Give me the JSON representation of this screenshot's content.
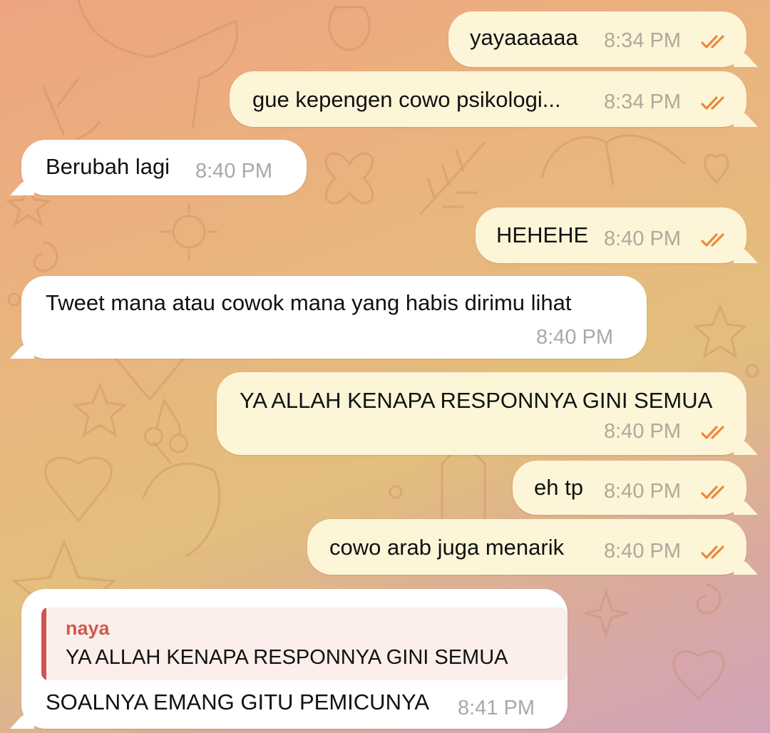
{
  "colors": {
    "outgoing_bubble": "#fdf5d8",
    "incoming_bubble": "#ffffff",
    "read_ticks": "#e8893b",
    "reply_accent": "#cf534f"
  },
  "messages": [
    {
      "direction": "out",
      "text": "yayaaaaaa",
      "time": "8:34 PM",
      "status": "read"
    },
    {
      "direction": "out",
      "text": "gue kepengen cowo psikologi...",
      "time": "8:34 PM",
      "status": "read"
    },
    {
      "direction": "in",
      "text": "Berubah lagi",
      "time": "8:40 PM"
    },
    {
      "direction": "out",
      "text": "HEHEHE",
      "time": "8:40 PM",
      "status": "read"
    },
    {
      "direction": "in",
      "text": "Tweet mana atau cowok mana yang habis dirimu lihat",
      "time": "8:40 PM"
    },
    {
      "direction": "out",
      "text": "YA ALLAH KENAPA RESPONNYA GINI SEMUA",
      "time": "8:40 PM",
      "status": "read"
    },
    {
      "direction": "out",
      "text": "eh tp",
      "time": "8:40 PM",
      "status": "read"
    },
    {
      "direction": "out",
      "text": "cowo arab juga menarik",
      "time": "8:40 PM",
      "status": "read"
    },
    {
      "direction": "in",
      "reply_to": {
        "name": "naya",
        "text": "YA ALLAH KENAPA RESPONNYA GINI SEMUA"
      },
      "text": "SOALNYA EMANG GITU PEMICUNYA",
      "time": "8:41 PM"
    }
  ]
}
